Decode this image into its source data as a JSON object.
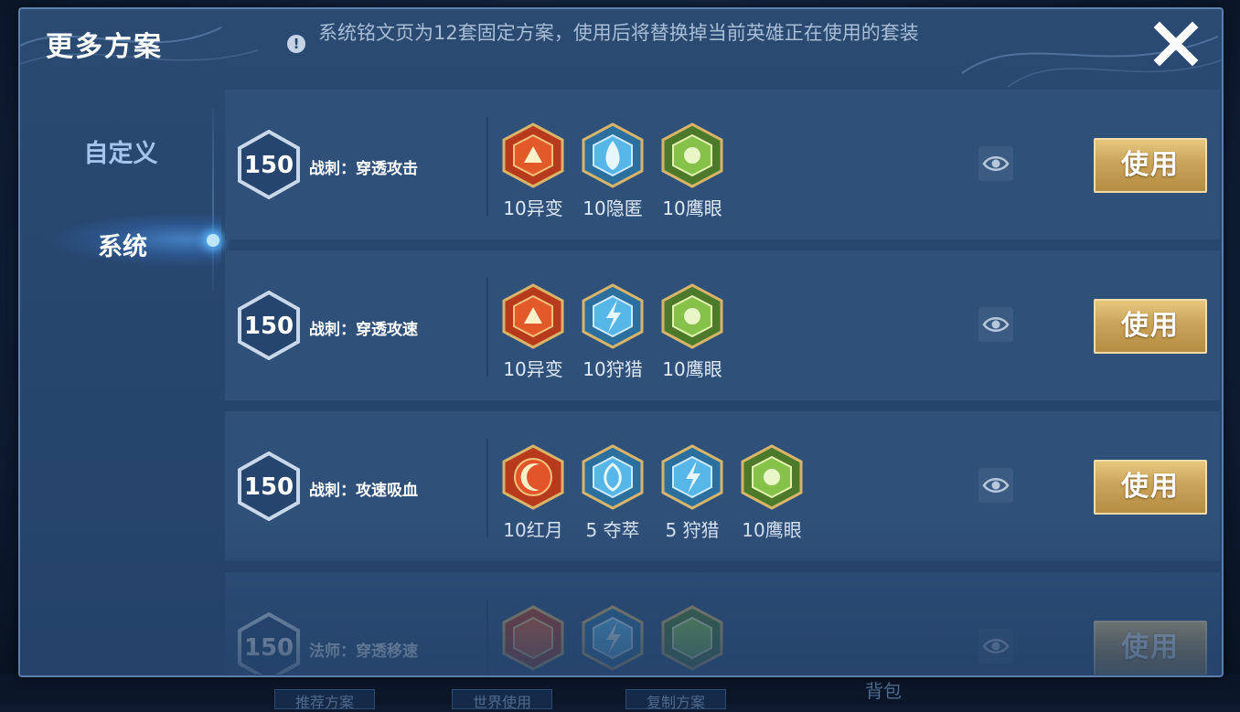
{
  "header": {
    "title": "更多方案",
    "notice": "系统铭文页为12套固定方案，使用后将替换掉当前英雄正在使用的套装"
  },
  "sidebar": {
    "items": [
      {
        "label": "自定义",
        "active": false
      },
      {
        "label": "系统",
        "active": true
      }
    ]
  },
  "plans": [
    {
      "level": "150",
      "name": "战刺：穿透攻击",
      "runes": [
        {
          "label": "10异变",
          "icon": "red-rune-icon"
        },
        {
          "label": "10隐匿",
          "icon": "blue-rune-icon"
        },
        {
          "label": "10鹰眼",
          "icon": "green-rune-icon"
        }
      ],
      "use_label": "使用"
    },
    {
      "level": "150",
      "name": "战刺：穿透攻速",
      "runes": [
        {
          "label": "10异变",
          "icon": "red-rune-icon"
        },
        {
          "label": "10狩猎",
          "icon": "blue-rune-icon"
        },
        {
          "label": "10鹰眼",
          "icon": "green-rune-icon"
        }
      ],
      "use_label": "使用"
    },
    {
      "level": "150",
      "name": "战刺：攻速吸血",
      "runes": [
        {
          "label": "10红月",
          "icon": "red-rune-icon"
        },
        {
          "label": "5 夺萃",
          "icon": "blue-rune-icon"
        },
        {
          "label": "5 狩猎",
          "icon": "blue-rune-icon"
        },
        {
          "label": "10鹰眼",
          "icon": "green-rune-icon"
        }
      ],
      "use_label": "使用"
    },
    {
      "level": "150",
      "name": "法师：穿透移速",
      "runes": [
        {
          "label": "",
          "icon": "red-rune-icon"
        },
        {
          "label": "",
          "icon": "blue-rune-icon"
        },
        {
          "label": "",
          "icon": "green-rune-icon"
        }
      ],
      "use_label": "使用"
    }
  ],
  "background": {
    "bottom_tabs": [
      "推荐方案",
      "世界使用",
      "复制方案"
    ],
    "bottom_right": "背包"
  },
  "colors": {
    "panel": "#2a4a72",
    "row": "#2f5079",
    "gold_button": "#c9a45a",
    "active_glow": "#59b6ff"
  }
}
